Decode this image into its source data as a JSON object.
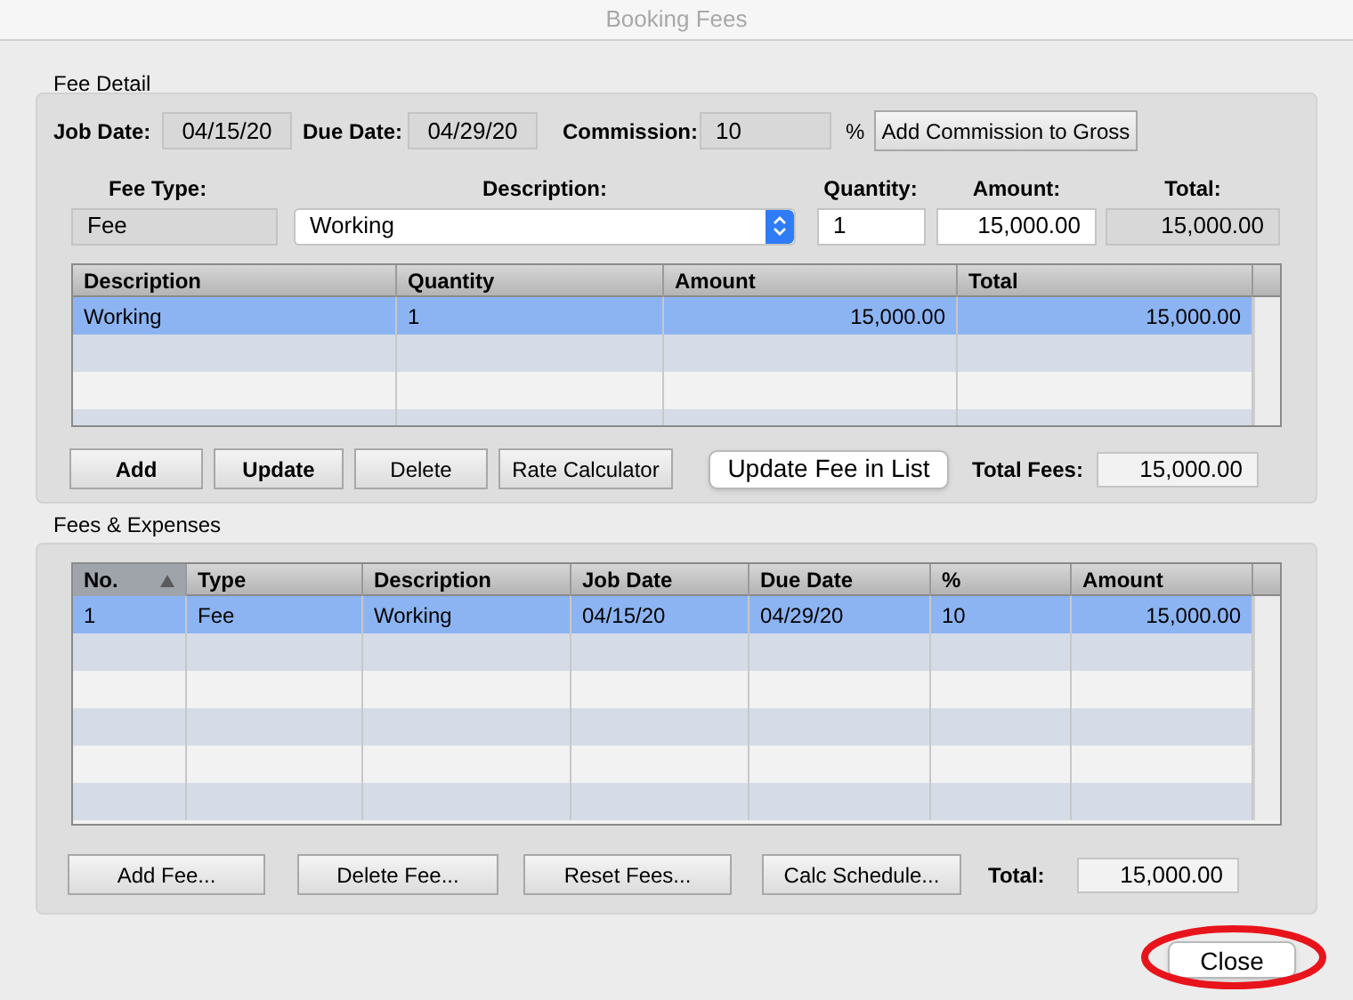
{
  "window": {
    "title": "Booking Fees"
  },
  "fee_detail": {
    "title": "Fee Detail",
    "job_date": {
      "label": "Job Date:",
      "value": "04/15/20",
      "editable": false
    },
    "due_date": {
      "label": "Due Date:",
      "value": "04/29/20",
      "editable": false
    },
    "commission": {
      "label": "Commission:",
      "value": "10",
      "editable": false,
      "unit": "%"
    },
    "add_commission_button": "Add Commission to Gross",
    "fee_type": {
      "label": "Fee Type:",
      "value": "Fee",
      "editable": false
    },
    "description": {
      "label": "Description:",
      "value": "Working"
    },
    "quantity": {
      "label": "Quantity:",
      "value": "1",
      "editable": true
    },
    "amount": {
      "label": "Amount:",
      "value": "15,000.00",
      "editable": true
    },
    "total": {
      "label": "Total:",
      "value": "15,000.00",
      "editable": false
    },
    "table": {
      "columns": [
        {
          "label": "Description",
          "numeric": false
        },
        {
          "label": "Quantity",
          "numeric": false
        },
        {
          "label": "Amount",
          "numeric": true
        },
        {
          "label": "Total",
          "numeric": true
        }
      ],
      "rows": [
        {
          "cells": [
            "Working",
            "1",
            "15,000.00",
            "15,000.00"
          ],
          "selected": true
        }
      ]
    },
    "buttons": [
      {
        "label": "Add",
        "kind": "bold"
      },
      {
        "label": "Update",
        "kind": "bold"
      },
      {
        "label": "Delete",
        "kind": "plain"
      },
      {
        "label": "Rate Calculator",
        "kind": "plain"
      },
      {
        "label": "Update Fee in List",
        "kind": "rounded"
      }
    ],
    "total_fees": {
      "label": "Total Fees:",
      "value": "15,000.00"
    }
  },
  "fees_expenses": {
    "title": "Fees & Expenses",
    "table": {
      "columns": [
        {
          "label": "No.",
          "numeric": false,
          "sorted": true
        },
        {
          "label": "Type",
          "numeric": false,
          "sorted": false
        },
        {
          "label": "Description",
          "numeric": false,
          "sorted": false
        },
        {
          "label": "Job Date",
          "numeric": false,
          "sorted": false
        },
        {
          "label": "Due Date",
          "numeric": false,
          "sorted": false
        },
        {
          "label": "%",
          "numeric": false,
          "sorted": false
        },
        {
          "label": "Amount",
          "numeric": true,
          "sorted": false
        }
      ],
      "rows": [
        {
          "cells": [
            "1",
            "Fee",
            "Working",
            "04/15/20",
            "04/29/20",
            "10",
            "15,000.00"
          ],
          "selected": true
        }
      ]
    },
    "buttons": [
      {
        "label": "Add Fee...",
        "kind": "plain"
      },
      {
        "label": "Delete Fee...",
        "kind": "plain"
      },
      {
        "label": "Reset Fees...",
        "kind": "plain"
      },
      {
        "label": "Calc Schedule...",
        "kind": "plain"
      }
    ],
    "total": {
      "label": "Total:",
      "value": "15,000.00"
    }
  },
  "close_button": {
    "label": "Close",
    "circled": true
  }
}
